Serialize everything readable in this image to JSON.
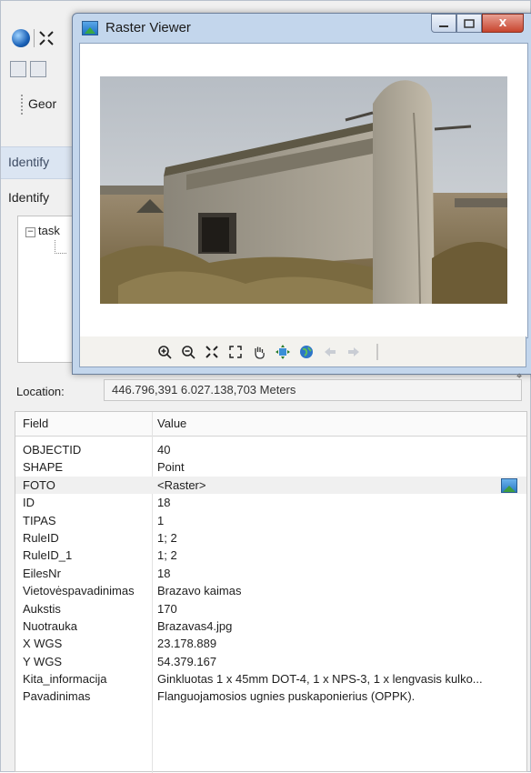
{
  "background": {
    "geo_label": "Geor",
    "identify_tab": "Identify",
    "identify_label": "Identify",
    "tree_item": "task"
  },
  "viewer": {
    "title": "Raster Viewer",
    "buttons": {
      "minimize": "▭",
      "maximize": "□",
      "close": "X"
    },
    "photo_alt": "Concrete bunker ruin in a field"
  },
  "location": {
    "label": "Location:",
    "value": "446.796,391  6.027.138,703 Meters"
  },
  "table": {
    "header_field": "Field",
    "header_value": "Value",
    "rows": [
      {
        "field": "OBJECTID",
        "value": "40"
      },
      {
        "field": "SHAPE",
        "value": "Point"
      },
      {
        "field": "FOTO",
        "value": "<Raster>"
      },
      {
        "field": "ID",
        "value": "18"
      },
      {
        "field": "TIPAS",
        "value": "1"
      },
      {
        "field": "RuleID",
        "value": "1; 2"
      },
      {
        "field": "RuleID_1",
        "value": "1; 2"
      },
      {
        "field": "EilesNr",
        "value": "18"
      },
      {
        "field": "Vietovėspavadinimas",
        "value": "Brazavo kaimas"
      },
      {
        "field": "Aukstis",
        "value": "170"
      },
      {
        "field": "Nuotrauka",
        "value": "Brazavas4.jpg"
      },
      {
        "field": "X WGS",
        "value": "23.178.889"
      },
      {
        "field": "Y WGS",
        "value": "54.379.167"
      },
      {
        "field": "Kita_informacija",
        "value": "Ginkluotas 1 x 45mm DOT-4, 1 x NPS-3, 1 x lengvasis kulko..."
      },
      {
        "field": "Pavadinimas",
        "value": "Flanguojamosios ugnies puskaponierius (OPPK)."
      }
    ]
  }
}
